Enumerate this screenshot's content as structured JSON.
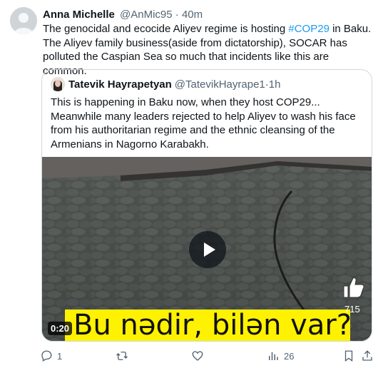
{
  "tweet": {
    "author_name": "Anna Michelle",
    "author_handle": "@AnMic95",
    "separator": "·",
    "time": "40m",
    "text_before": "The genocidal and ecocide Aliyev regime is hosting ",
    "hashtag": "#COP29",
    "text_after": " in Baku. The Aliyev family business(aside from dictatorship), SOCAR has polluted the Caspian Sea so much that incidents like this are common."
  },
  "quote": {
    "author_name": "Tatevik Hayrapetyan",
    "author_handle": "@TatevikHayrape1",
    "separator": "·",
    "time": "1h",
    "text": "This is happening in Baku now, when they host COP29... Meanwhile many leaders rejected to help Aliyev to wash his face from his authoritarian regime and the ethnic cleansing of the Armenians in Nagorno Karabakh.",
    "video": {
      "duration": "0:20",
      "caption": "Bu nədir, bilən var?",
      "like_count": "715"
    }
  },
  "actions": {
    "reply_count": "1",
    "retweet_count": "",
    "like_count": "",
    "view_count": "26"
  },
  "colors": {
    "hashtag": "#1d9bf0",
    "muted": "#536471",
    "caption_bg": "#fff200"
  }
}
